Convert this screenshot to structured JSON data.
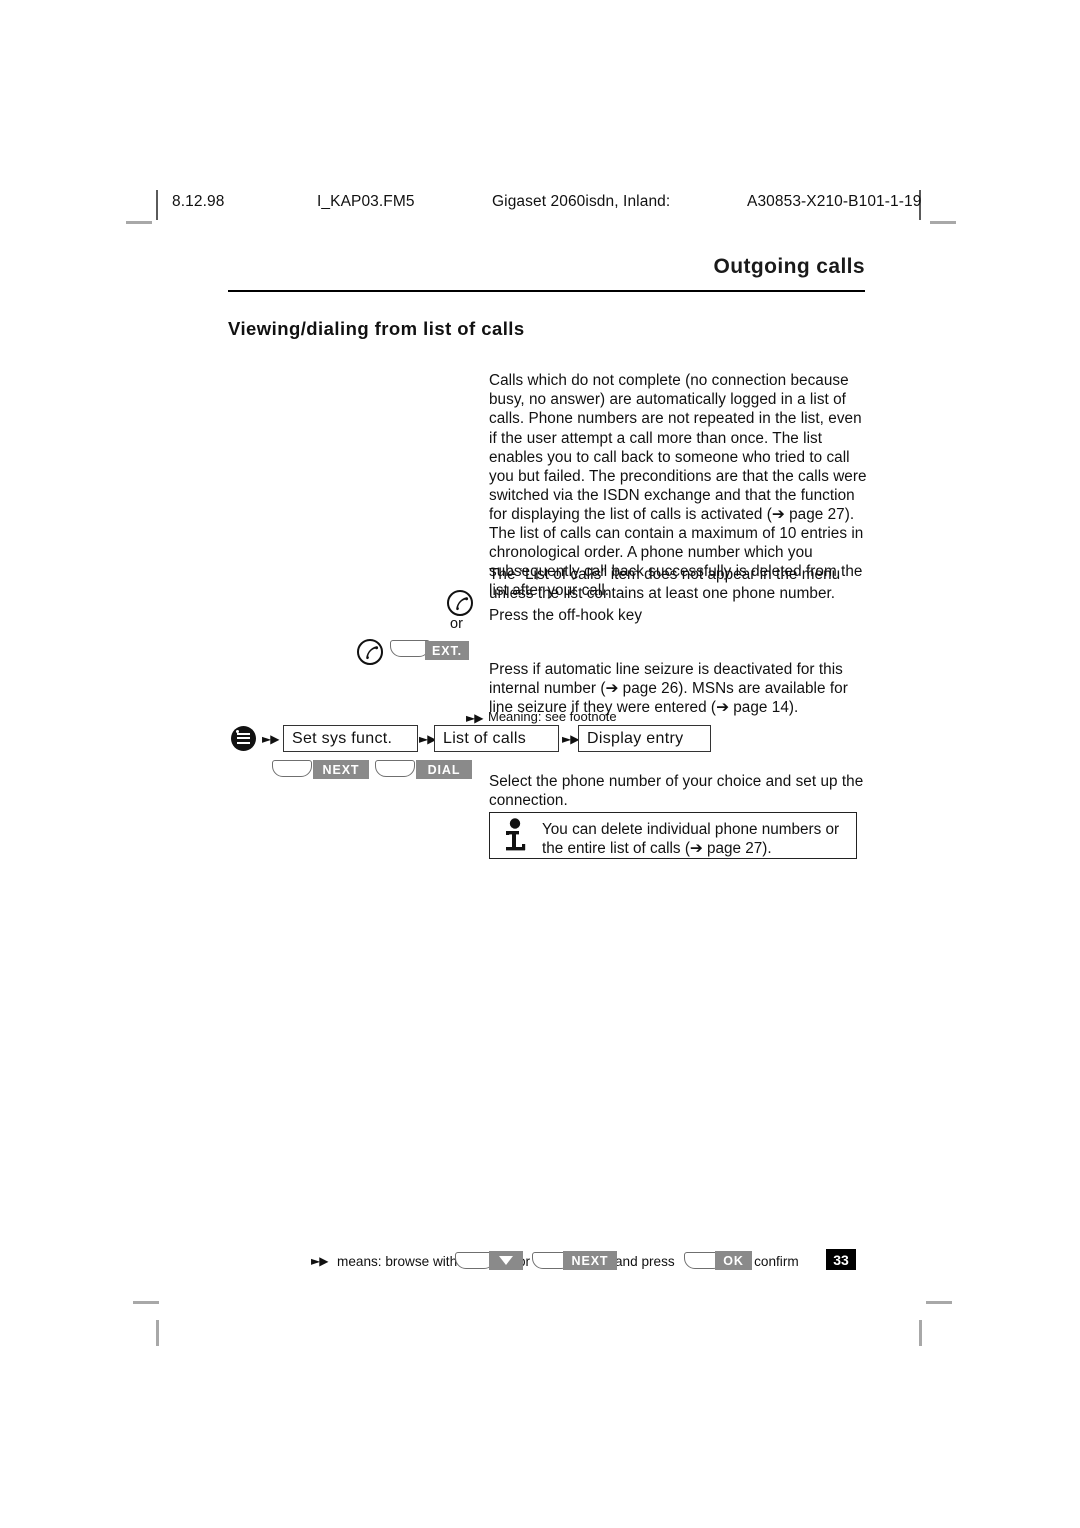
{
  "running_header": {
    "date": "8.12.98",
    "filename": "I_KAP03.FM5",
    "product": "Gigaset 2060isdn, Inland:",
    "order_number": "A30853-X210-B101-1-19"
  },
  "chapter_title": "Outgoing calls",
  "section_title": "Viewing/dialing from list of calls",
  "body": {
    "intro": "Calls which do not complete (no connection because busy, no answer) are automatically logged in a list of calls. Phone numbers are not repeated in the list, even if the user attempt a call more than once. The list enables you to call back to someone who tried to call you but failed. The preconditions are that the calls were switched via the ISDN exchange and that the function for displaying the list of calls is activated (➔ page 27). The list of calls can contain a maximum of 10 entries in chronological order. A phone number which you subsequently call back successfully is deleted from the list after your call.",
    "note": "The “List of calls” item does not appear in the menu unless the list contains at least one phone number.",
    "offhook_instruction": "Press the off-hook key",
    "or_label": "or",
    "ext_instruction": "Press if automatic line seizure is deactivated for this internal number (➔ page 26). MSNs are available for line seizure if they were entered (➔ page 14).",
    "select_instruction": "Select the phone number of your choice and set up the connection."
  },
  "menu_path": {
    "browse_symbol": "►▶",
    "footnote_tag": "Meaning: see footnote",
    "steps": [
      {
        "label": "Set sys funct."
      },
      {
        "label": "List of calls"
      },
      {
        "label": "Display entry"
      }
    ],
    "softkeys": [
      {
        "label": "NEXT"
      },
      {
        "label": "DIAL"
      }
    ]
  },
  "keys": {
    "ext_label": "EXT.",
    "menu_icon": "menu-icon",
    "offhook_icon": "off-hook-handset-icon"
  },
  "info_note": {
    "icon": "information-i-icon",
    "text": "You can delete individual phone numbers or the entire list of calls (➔ page 27)."
  },
  "footer": {
    "browse_symbol": "►▶",
    "means_text": "means: browse with",
    "or_text": "or",
    "and_press_text": "and press",
    "confirm_text": "to confirm",
    "down_key_label": "▼",
    "next_key_label": "NEXT",
    "ok_key_label": "OK",
    "page_number": "33"
  },
  "colors": {
    "key_label_gray": "#8a8a8a",
    "page_number_bg": "#000000",
    "text": "#111111"
  }
}
